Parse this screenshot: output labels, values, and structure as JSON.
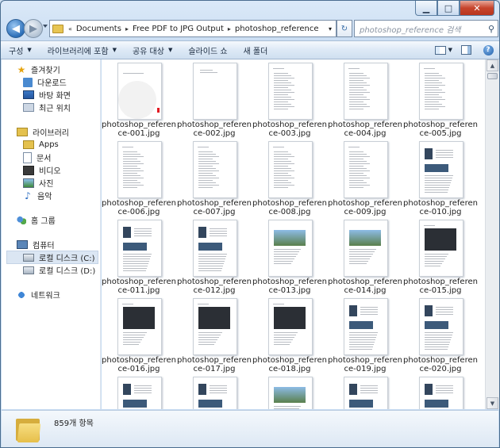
{
  "window": {
    "caption_buttons": {
      "minimize": "▁",
      "maximize": "□",
      "close": "✕"
    }
  },
  "address_bar": {
    "prefix": "«",
    "crumbs": [
      "Documents",
      "Free PDF to JPG Output",
      "photoshop_reference"
    ],
    "separator": "▸",
    "dropdown": "▾",
    "refresh": "↻"
  },
  "search": {
    "placeholder": "photoshop_reference 검색",
    "icon": "search-icon"
  },
  "nav_buttons": {
    "back": "◀",
    "forward": "▶"
  },
  "toolbar": {
    "organize": "구성",
    "include_library": "라이브러리에 포함",
    "share": "공유 대상",
    "slideshow": "슬라이드 쇼",
    "new_folder": "새 폴더",
    "help": "?"
  },
  "nav_pane": {
    "favorites": "즐겨찾기",
    "downloads": "다운로드",
    "desktop": "바탕 화면",
    "recent": "최근 위치",
    "libraries": "라이브러리",
    "apps": "Apps",
    "documents": "문서",
    "videos": "비디오",
    "pictures": "사진",
    "music": "음악",
    "homegroup": "홈 그룹",
    "computer": "컴퓨터",
    "local_c": "로컬 디스크 (C:)",
    "local_d": "로컬 디스크 (D:)",
    "network": "네트워크"
  },
  "files": [
    "photoshop_reference-001.jpg",
    "photoshop_reference-002.jpg",
    "photoshop_reference-003.jpg",
    "photoshop_reference-004.jpg",
    "photoshop_reference-005.jpg",
    "photoshop_reference-006.jpg",
    "photoshop_reference-007.jpg",
    "photoshop_reference-008.jpg",
    "photoshop_reference-009.jpg",
    "photoshop_reference-010.jpg",
    "photoshop_reference-011.jpg",
    "photoshop_reference-012.jpg",
    "photoshop_reference-013.jpg",
    "photoshop_reference-014.jpg",
    "photoshop_reference-015.jpg",
    "photoshop_reference-016.jpg",
    "photoshop_reference-017.jpg",
    "photoshop_reference-018.jpg",
    "photoshop_reference-019.jpg",
    "photoshop_reference-020.jpg",
    "",
    "",
    "",
    "",
    ""
  ],
  "details": {
    "item_count": "859개 항목"
  },
  "colors": {
    "accent": "#2c6fb8",
    "close": "#c7452d",
    "folder": "#e6bf4a"
  }
}
